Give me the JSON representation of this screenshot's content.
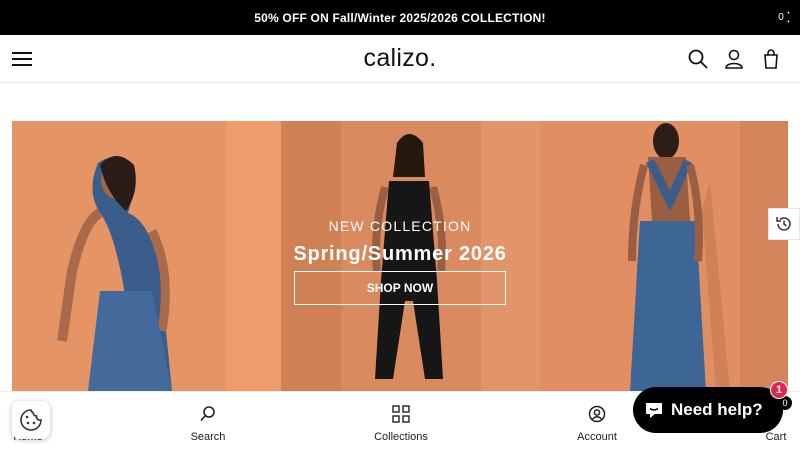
{
  "promo": {
    "text": "50% OFF ON Fall/Winter 2025/2026 COLLECTION!"
  },
  "header": {
    "logo": "calizo.",
    "cart_count": "0"
  },
  "hero": {
    "subtitle": "NEW COLLECTION",
    "title": "Spring/Summer 2026",
    "cta": "SHOP NOW"
  },
  "bottom_nav": {
    "items": [
      {
        "label": "Home",
        "icon": "home-icon"
      },
      {
        "label": "Search",
        "icon": "search-icon"
      },
      {
        "label": "Collections",
        "icon": "grid-icon"
      },
      {
        "label": "Account",
        "icon": "account-icon"
      },
      {
        "label": "Cart",
        "icon": "cart-icon"
      }
    ],
    "cart_count": "0"
  },
  "chat": {
    "label": "Need help?",
    "badge": "1"
  },
  "colors": {
    "promo_bg": "#000000",
    "hero_bg": "#e8966a",
    "badge": "#e0264b"
  }
}
